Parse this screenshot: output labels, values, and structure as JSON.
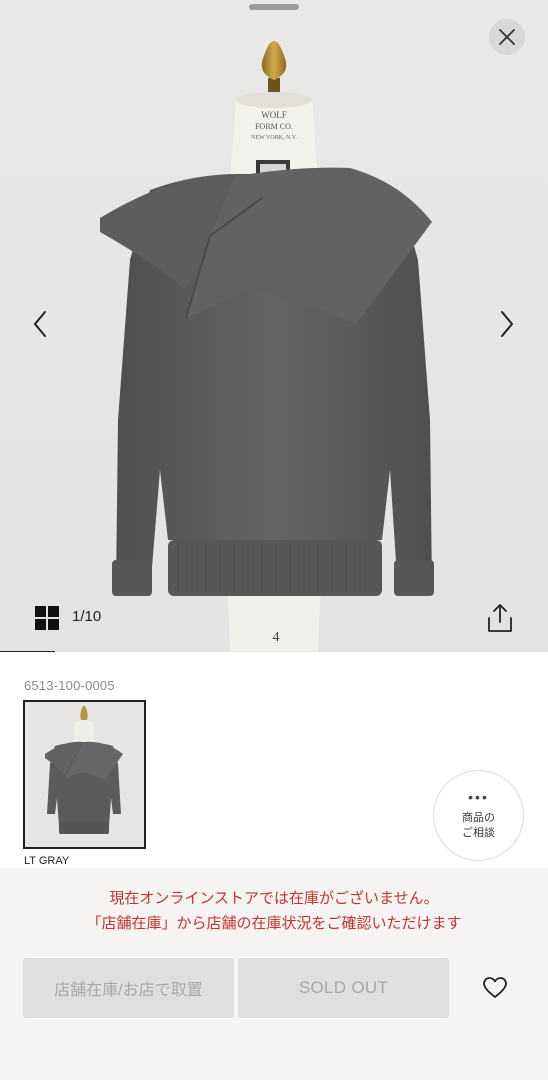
{
  "gallery": {
    "counter": "1/10",
    "current_index": 1,
    "total": 10,
    "progress_fraction": 0.1,
    "mannequin_tag_lines": [
      "WOLF",
      "FORM CO.",
      "NEW YORK, N.Y."
    ],
    "mannequin_number": "4"
  },
  "icons": {
    "close": "close-icon",
    "prev": "chevron-left-icon",
    "next": "chevron-right-icon",
    "grid": "grid-icon",
    "share": "share-icon",
    "favorite": "heart-icon",
    "consult": "more-dots-icon"
  },
  "product": {
    "code": "6513-100-0005",
    "color_label": "LT GRAY"
  },
  "consult": {
    "dots": "•••",
    "label": "商品の\nご相談"
  },
  "stock_message": {
    "line1": "現在オンラインストアでは在庫がございません。",
    "line2": "「店舗在庫」から店舗の在庫状況をご確認いただけます"
  },
  "actions": {
    "store_stock_label": "店舗在庫/お店で取置",
    "sold_out_label": "SOLD OUT"
  },
  "colors": {
    "accent_red": "#c8322e",
    "disabled_button": "#e0dfdd",
    "disabled_text": "#a9a8a6",
    "garment_gray": "#5e5e5e"
  }
}
